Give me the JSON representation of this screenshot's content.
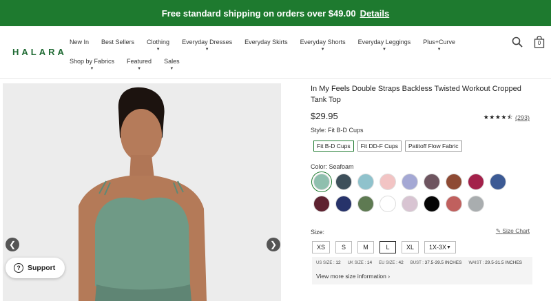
{
  "promo": {
    "text": "Free standard shipping on orders over $49.00",
    "link": "Details"
  },
  "brand": "HALARA",
  "nav_row1": [
    {
      "label": "New In",
      "dropdown": false
    },
    {
      "label": "Best Sellers",
      "dropdown": false
    },
    {
      "label": "Clothing",
      "dropdown": true
    },
    {
      "label": "Everyday Dresses",
      "dropdown": true
    },
    {
      "label": "Everyday Skirts",
      "dropdown": false
    },
    {
      "label": "Everyday Shorts",
      "dropdown": true
    },
    {
      "label": "Everyday Leggings",
      "dropdown": true
    },
    {
      "label": "Plus+Curve",
      "dropdown": true
    }
  ],
  "nav_row2": [
    {
      "label": "Shop by Fabrics",
      "dropdown": true
    },
    {
      "label": "Featured",
      "dropdown": true
    },
    {
      "label": "Sales",
      "dropdown": true
    }
  ],
  "cart_count": "0",
  "product": {
    "title": "In My Feels Double Straps Backless Twisted Workout Cropped Tank Top",
    "price": "$29.95",
    "rating": 4.5,
    "reviews": "(293)",
    "style_label": "Style: Fit B-D Cups",
    "styles": [
      "Fit B-D Cups",
      "Fit DD-F Cups",
      "Patitoff Flow Fabric"
    ],
    "color_label": "Color: Seafoam",
    "colors_row1": [
      "#8fbfae",
      "#3d4f5a",
      "#8fc2cc",
      "#f2c4c4",
      "#a4a8d4",
      "#6e5560",
      "#8e4a34",
      "#a3214a",
      "#3c5a94"
    ],
    "colors_row2": [
      "#5e2230",
      "#27336a",
      "#5e7a52",
      "#ffffff",
      "#d8c4d2",
      "#050505",
      "#c0605e",
      "#a9adaf"
    ],
    "size_label": "Size:",
    "size_chart": "Size Chart",
    "sizes": [
      "XS",
      "S",
      "M",
      "L",
      "XL",
      "1X-3X"
    ],
    "size_info": {
      "us_label": "US SIZE :",
      "us_value": "12",
      "uk_label": "UK SIZE :",
      "uk_value": "14",
      "eu_label": "EU SIZE :",
      "eu_value": "42",
      "bust_label": "BUST :",
      "bust_value": "37.5-39.5 INCHES",
      "waist_label": "WAIST :",
      "waist_value": "29.5-31.5 INCHES"
    },
    "more_info": "View more size information"
  },
  "support": "Support",
  "icons": {
    "search": "search-icon",
    "bag": "shopping-bag-icon",
    "prev": "chevron-left-icon",
    "next": "chevron-right-icon",
    "help": "question-icon",
    "ruler": "ruler-icon"
  },
  "colors": {
    "brand_green": "#1e7a2f",
    "logo_green": "#1f6a33"
  }
}
